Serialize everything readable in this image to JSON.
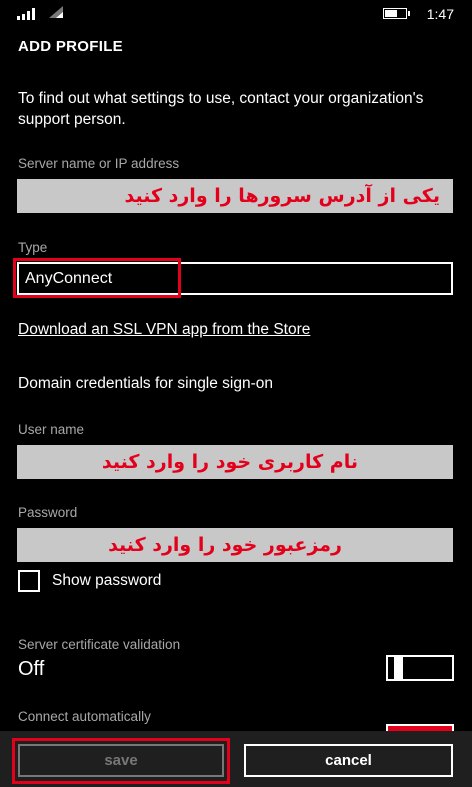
{
  "status": {
    "time": "1:47"
  },
  "page": {
    "title": "ADD PROFILE"
  },
  "intro": "To find out what settings to use, contact your organization's support person.",
  "server": {
    "label": "Server name or IP address",
    "overlay": "یکی از آدرس سرورها را وارد کنید"
  },
  "type": {
    "label": "Type",
    "value": "AnyConnect"
  },
  "download_link": "Download an SSL VPN app from the Store",
  "domain_credentials": "Domain credentials for single sign-on",
  "username": {
    "label": "User name",
    "overlay": "نام کاربری خود را وارد کنید"
  },
  "password": {
    "label": "Password",
    "overlay": "رمزعبور خود را وارد کنید"
  },
  "show_password": {
    "label": "Show password"
  },
  "cert_validation": {
    "label": "Server certificate validation",
    "value": "Off"
  },
  "connect_auto": {
    "label": "Connect automatically"
  },
  "appbar": {
    "save": "save",
    "cancel": "cancel"
  },
  "colors": {
    "accent": "#e3001b",
    "background": "#000000",
    "field_bg": "#c8c8c8"
  }
}
